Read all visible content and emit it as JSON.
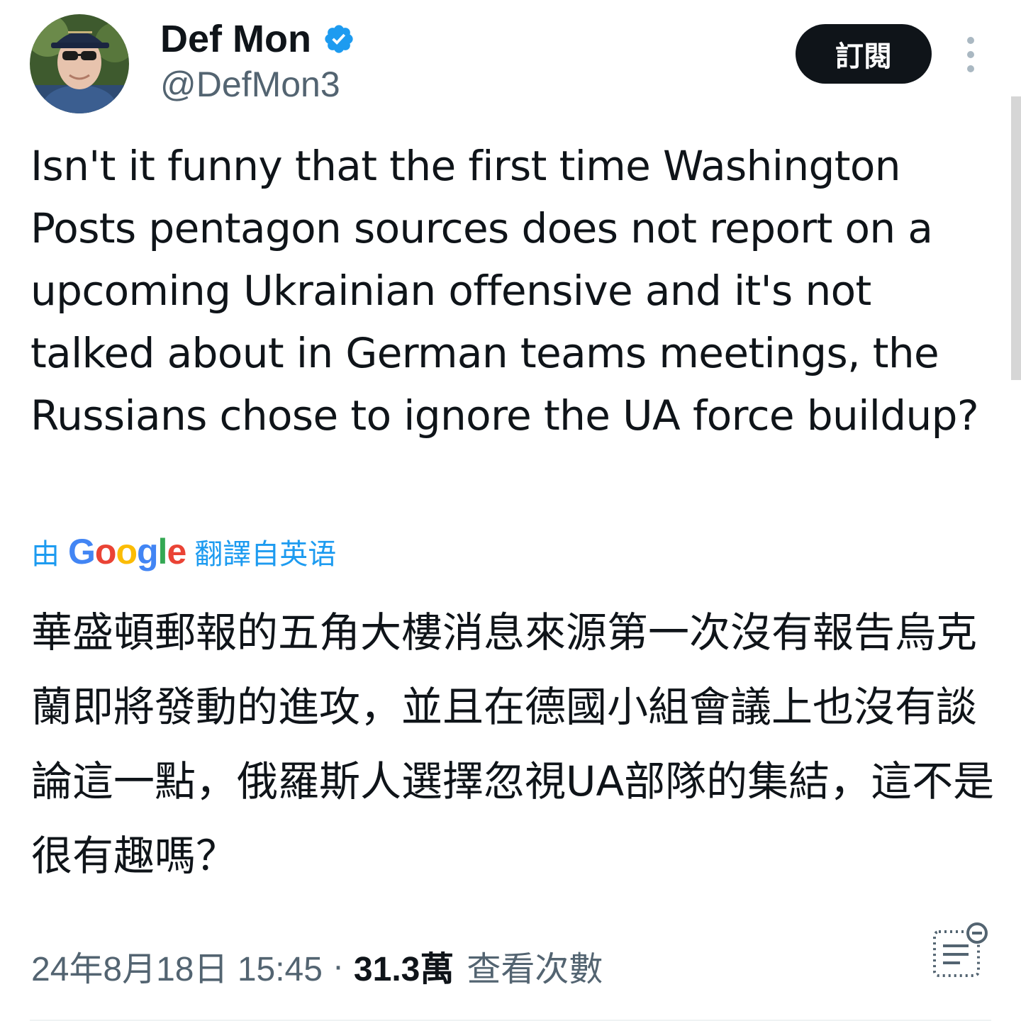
{
  "author": {
    "display_name": "Def Mon",
    "handle": "@DefMon3",
    "verified": true,
    "verified_color": "#1d9bf0"
  },
  "header": {
    "subscribe_label": "訂閱",
    "more_icon": "vertical-ellipsis-icon"
  },
  "tweet": {
    "text": "Isn't it funny that the first time Washington Posts pentagon sources does not report on a upcoming Ukrainian offensive and it's not talked about in German teams meetings, the Russians chose to ignore the UA force buildup?"
  },
  "translation": {
    "prefix": "由",
    "provider_logo_letters": [
      "G",
      "o",
      "o",
      "g",
      "l",
      "e"
    ],
    "provider_logo_colors": [
      "#4285f4",
      "#ea4335",
      "#fbbc05",
      "#4285f4",
      "#34a853",
      "#ea4335"
    ],
    "suffix": "翻譯自英语",
    "text": "華盛頓郵報的五角大樓消息來源第一次沒有報告烏克蘭即將發動的進攻，並且在德國小組會議上也沒有談論這一點，俄羅斯人選擇忽視UA部隊的集結，這不是很有趣嗎？"
  },
  "meta": {
    "timestamp": "24年8月18日 15:45",
    "separator": "·",
    "views_count": "31.3萬",
    "views_label": "查看次數",
    "notes_icon": "community-notes-icon"
  },
  "colors": {
    "text_primary": "#0f1419",
    "text_secondary": "#536471",
    "accent": "#1d9bf0"
  }
}
